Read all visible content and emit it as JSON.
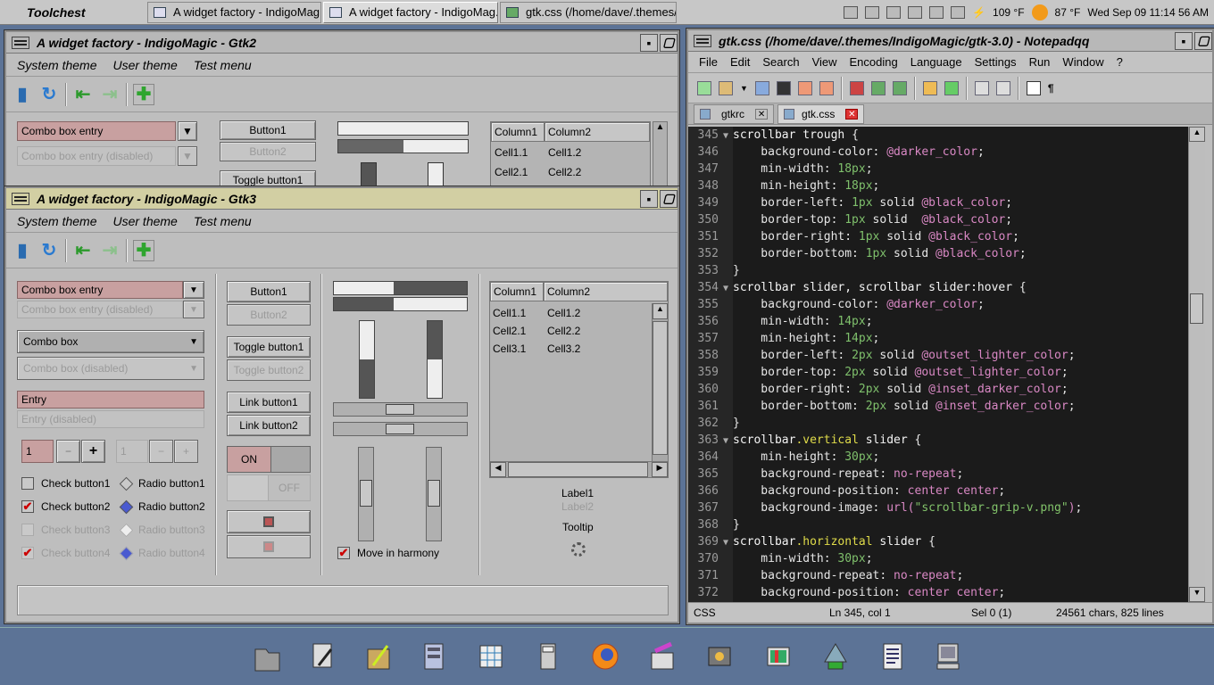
{
  "topbar": {
    "toolchest": "Toolchest",
    "tasks": [
      "A widget factory - IndigoMag...",
      "A widget factory - IndigoMag...",
      "gtk.css (/home/dave/.themes/..."
    ],
    "temp1": "109 °F",
    "temp2": "87 °F",
    "clock": "Wed Sep 09  11:14 56 AM"
  },
  "gtk2": {
    "title": "A widget factory - IndigoMagic - Gtk2",
    "menus": [
      "System theme",
      "User theme",
      "Test menu"
    ],
    "combo_entry": "Combo box entry",
    "combo_entry_dis": "Combo box entry (disabled)",
    "button1": "Button1",
    "button2": "Button2",
    "toggle1": "Toggle button1",
    "col1": "Column1",
    "col2": "Column2",
    "rows": [
      [
        "Cell1.1",
        "Cell1.2"
      ],
      [
        "Cell2.1",
        "Cell2.2"
      ]
    ]
  },
  "gtk3": {
    "title": "A widget factory - IndigoMagic - Gtk3",
    "menus": [
      "System theme",
      "User theme",
      "Test menu"
    ],
    "combo_entry": "Combo box entry",
    "combo_entry_dis": "Combo box entry (disabled)",
    "combo": "Combo box",
    "combo_dis": "Combo box (disabled)",
    "entry": "Entry",
    "entry_dis": "Entry (disabled)",
    "spin1": "1",
    "spin2": "1",
    "minus": "−",
    "plus": "+",
    "check1": "Check button1",
    "check2": "Check button2",
    "check3": "Check button3",
    "check4": "Check button4",
    "radio1": "Radio button1",
    "radio2": "Radio button2",
    "radio3": "Radio button3",
    "radio4": "Radio button4",
    "button1": "Button1",
    "button2": "Button2",
    "toggle1": "Toggle button1",
    "toggle2": "Toggle button2",
    "link1": "Link button1",
    "link2": "Link button2",
    "on": "ON",
    "off": "OFF",
    "move": "Move in harmony",
    "col1": "Column1",
    "col2": "Column2",
    "rows": [
      [
        "Cell1.1",
        "Cell1.2"
      ],
      [
        "Cell2.1",
        "Cell2.2"
      ],
      [
        "Cell3.1",
        "Cell3.2"
      ]
    ],
    "label1": "Label1",
    "label2": "Label2",
    "tooltip": "Tooltip",
    "progress1": 0.45,
    "progress2": 0.45
  },
  "notepad": {
    "title": "gtk.css (/home/dave/.themes/IndigoMagic/gtk-3.0) - Notepadqq",
    "menus": [
      "File",
      "Edit",
      "Search",
      "View",
      "Encoding",
      "Language",
      "Settings",
      "Run",
      "Window",
      "?"
    ],
    "tabs": [
      "gtkrc",
      "gtk.css"
    ],
    "status": {
      "lang": "CSS",
      "pos": "Ln 345, col 1",
      "sel": "Sel 0 (1)",
      "chars": "24561 chars, 825 lines"
    },
    "lines": [
      {
        "n": "345",
        "fold": "▼",
        "parts": [
          [
            "sel",
            "scrollbar trough "
          ],
          [
            "punct",
            "{"
          ]
        ]
      },
      {
        "n": "346",
        "parts": [
          [
            "prop",
            "    background-color: "
          ],
          [
            "var",
            "@darker_color"
          ],
          [
            "punct",
            ";"
          ]
        ]
      },
      {
        "n": "347",
        "parts": [
          [
            "prop",
            "    min-width: "
          ],
          [
            "val",
            "18px"
          ],
          [
            "punct",
            ";"
          ]
        ]
      },
      {
        "n": "348",
        "parts": [
          [
            "prop",
            "    min-height: "
          ],
          [
            "val",
            "18px"
          ],
          [
            "punct",
            ";"
          ]
        ]
      },
      {
        "n": "349",
        "parts": [
          [
            "prop",
            "    border-left: "
          ],
          [
            "val",
            "1px"
          ],
          [
            "prop",
            " solid "
          ],
          [
            "var",
            "@black_color"
          ],
          [
            "punct",
            ";"
          ]
        ]
      },
      {
        "n": "350",
        "parts": [
          [
            "prop",
            "    border-top: "
          ],
          [
            "val",
            "1px"
          ],
          [
            "prop",
            " solid  "
          ],
          [
            "var",
            "@black_color"
          ],
          [
            "punct",
            ";"
          ]
        ]
      },
      {
        "n": "351",
        "parts": [
          [
            "prop",
            "    border-right: "
          ],
          [
            "val",
            "1px"
          ],
          [
            "prop",
            " solid "
          ],
          [
            "var",
            "@black_color"
          ],
          [
            "punct",
            ";"
          ]
        ]
      },
      {
        "n": "352",
        "parts": [
          [
            "prop",
            "    border-bottom: "
          ],
          [
            "val",
            "1px"
          ],
          [
            "prop",
            " solid "
          ],
          [
            "var",
            "@black_color"
          ],
          [
            "punct",
            ";"
          ]
        ]
      },
      {
        "n": "353",
        "parts": [
          [
            "punct",
            "}"
          ]
        ]
      },
      {
        "n": "354",
        "fold": "▼",
        "parts": [
          [
            "sel",
            "scrollbar slider, scrollbar slider:hover "
          ],
          [
            "punct",
            "{"
          ]
        ]
      },
      {
        "n": "355",
        "parts": [
          [
            "prop",
            "    background-color: "
          ],
          [
            "var",
            "@darker_color"
          ],
          [
            "punct",
            ";"
          ]
        ]
      },
      {
        "n": "356",
        "parts": [
          [
            "prop",
            "    min-width: "
          ],
          [
            "val",
            "14px"
          ],
          [
            "punct",
            ";"
          ]
        ]
      },
      {
        "n": "357",
        "parts": [
          [
            "prop",
            "    min-height: "
          ],
          [
            "val",
            "14px"
          ],
          [
            "punct",
            ";"
          ]
        ]
      },
      {
        "n": "358",
        "parts": [
          [
            "prop",
            "    border-left: "
          ],
          [
            "val",
            "2px"
          ],
          [
            "prop",
            " solid "
          ],
          [
            "var",
            "@outset_lighter_color"
          ],
          [
            "punct",
            ";"
          ]
        ]
      },
      {
        "n": "359",
        "parts": [
          [
            "prop",
            "    border-top: "
          ],
          [
            "val",
            "2px"
          ],
          [
            "prop",
            " solid "
          ],
          [
            "var",
            "@outset_lighter_color"
          ],
          [
            "punct",
            ";"
          ]
        ]
      },
      {
        "n": "360",
        "parts": [
          [
            "prop",
            "    border-right: "
          ],
          [
            "val",
            "2px"
          ],
          [
            "prop",
            " solid "
          ],
          [
            "var",
            "@inset_darker_color"
          ],
          [
            "punct",
            ";"
          ]
        ]
      },
      {
        "n": "361",
        "parts": [
          [
            "prop",
            "    border-bottom: "
          ],
          [
            "val",
            "2px"
          ],
          [
            "prop",
            " solid "
          ],
          [
            "var",
            "@inset_darker_color"
          ],
          [
            "punct",
            ";"
          ]
        ]
      },
      {
        "n": "362",
        "parts": [
          [
            "punct",
            "}"
          ]
        ]
      },
      {
        "n": "363",
        "fold": "▼",
        "parts": [
          [
            "sel",
            "scrollbar"
          ],
          [
            "cls",
            ".vertical"
          ],
          [
            "sel",
            " slider "
          ],
          [
            "punct",
            "{"
          ]
        ]
      },
      {
        "n": "364",
        "parts": [
          [
            "prop",
            "    min-height: "
          ],
          [
            "val",
            "30px"
          ],
          [
            "punct",
            ";"
          ]
        ]
      },
      {
        "n": "365",
        "parts": [
          [
            "prop",
            "    background-repeat: "
          ],
          [
            "var",
            "no-repeat"
          ],
          [
            "punct",
            ";"
          ]
        ]
      },
      {
        "n": "366",
        "parts": [
          [
            "prop",
            "    background-position: "
          ],
          [
            "var",
            "center center"
          ],
          [
            "punct",
            ";"
          ]
        ]
      },
      {
        "n": "367",
        "parts": [
          [
            "prop",
            "    background-image: "
          ],
          [
            "var",
            "url("
          ],
          [
            "str",
            "\"scrollbar-grip-v.png\""
          ],
          [
            "var",
            ")"
          ],
          [
            "punct",
            ";"
          ]
        ]
      },
      {
        "n": "368",
        "parts": [
          [
            "punct",
            "}"
          ]
        ]
      },
      {
        "n": "369",
        "fold": "▼",
        "parts": [
          [
            "sel",
            "scrollbar"
          ],
          [
            "cls",
            ".horizontal"
          ],
          [
            "sel",
            " slider "
          ],
          [
            "punct",
            "{"
          ]
        ]
      },
      {
        "n": "370",
        "parts": [
          [
            "prop",
            "    min-width: "
          ],
          [
            "val",
            "30px"
          ],
          [
            "punct",
            ";"
          ]
        ]
      },
      {
        "n": "371",
        "parts": [
          [
            "prop",
            "    background-repeat: "
          ],
          [
            "var",
            "no-repeat"
          ],
          [
            "punct",
            ";"
          ]
        ]
      },
      {
        "n": "372",
        "parts": [
          [
            "prop",
            "    background-position: "
          ],
          [
            "var",
            "center center"
          ],
          [
            "punct",
            ";"
          ]
        ]
      }
    ]
  }
}
